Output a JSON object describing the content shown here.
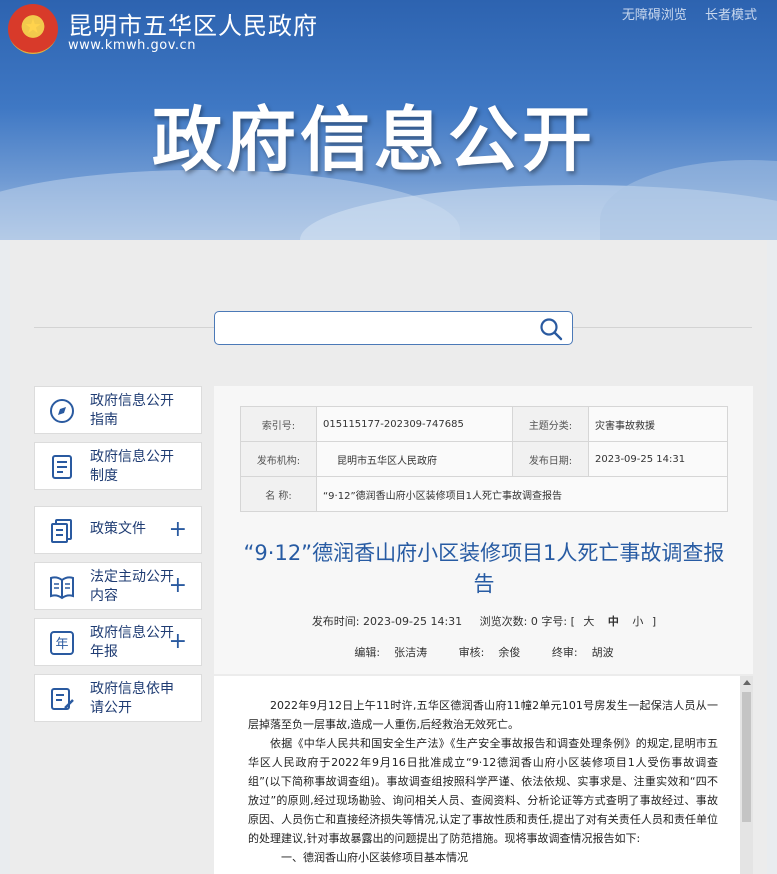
{
  "header": {
    "site_name": "昆明市五华区人民政府",
    "site_url": "www.kmwh.gov.cn",
    "accessibility_link": "无障碍浏览",
    "elder_mode_link": "长者模式",
    "banner_title": "政府信息公开"
  },
  "search": {
    "placeholder": "",
    "value": ""
  },
  "sidebar": {
    "items": [
      {
        "label": "政府信息公开指南",
        "icon": "compass-icon",
        "expandable": false
      },
      {
        "label": "政府信息公开制度",
        "icon": "document-icon",
        "expandable": false
      },
      {
        "label": "政策文件",
        "icon": "files-icon",
        "expandable": true
      },
      {
        "label": "法定主动公开内容",
        "icon": "book-icon",
        "expandable": true
      },
      {
        "label": "政府信息公开年报",
        "icon": "year-icon",
        "expandable": true
      },
      {
        "label": "政府信息依申请公开",
        "icon": "form-icon",
        "expandable": false
      }
    ],
    "plus_symbol": "+"
  },
  "meta_table": {
    "index_label": "索引号:",
    "index_value": "015115177-202309-747685",
    "topic_label": "主题分类:",
    "topic_value": "灾害事故救援",
    "org_label": "发布机构:",
    "org_value": "昆明市五华区人民政府",
    "date_label": "发布日期:",
    "date_value": "2023-09-25 14:31",
    "name_label": "名 称:",
    "name_value": "“9·12”德润香山府小区装修项目1人死亡事故调查报告"
  },
  "article": {
    "title": "“9·12”德润香山府小区装修项目1人死亡事故调查报告",
    "publish_label": "发布时间:",
    "publish_time": "2023-09-25 14:31",
    "views_label": "浏览次数:",
    "views": "0",
    "font_label": "字号:",
    "bracket_open": "[",
    "bracket_close": "]",
    "size_large": "大",
    "size_medium": "中",
    "size_small": "小",
    "editor_label": "编辑:",
    "editor": "张洁涛",
    "reviewer_label": "审核:",
    "reviewer": "余俊",
    "final_label": "终审:",
    "final_reviewer": "胡波"
  },
  "body": {
    "paragraphs": [
      "2022年9月12日上午11时许,五华区德润香山府11幢2单元101号房发生一起保洁人员从一层掉落至负一层事故,造成一人重伤,后经救治无效死亡。",
      "依据《中华人民共和国安全生产法》《生产安全事故报告和调查处理条例》的规定,昆明市五华区人民政府于2022年9月16日批准成立“9·12德润香山府小区装修项目1人受伤事故调查组”(以下简称事故调查组)。事故调查组按照科学严谨、依法依规、实事求是、注重实效和“四不放过”的原则,经过现场勘验、询问相关人员、查阅资料、分析论证等方式查明了事故经过、事故原因、人员伤亡和直接经济损失等情况,认定了事故性质和责任,提出了对有关责任人员和责任单位的处理建议,针对事故暴露出的问题提出了防范措施。现将事故调查情况报告如下:",
      "一、德润香山府小区装修项目基本情况"
    ]
  }
}
